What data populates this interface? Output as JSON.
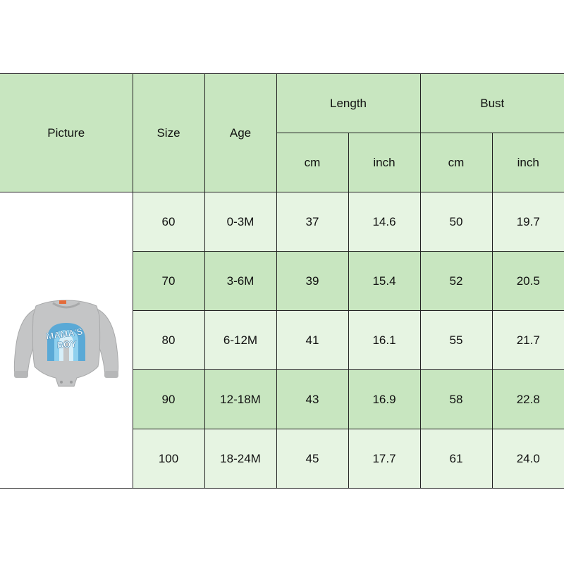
{
  "headers": {
    "picture": "Picture",
    "size": "Size",
    "age": "Age",
    "length": "Length",
    "bust": "Bust",
    "cm": "cm",
    "inch": "inch"
  },
  "product": {
    "print_text_line1": "MAMA'S",
    "print_text_line2": "BOY",
    "garment_color": "#c4c5c6",
    "rainbow_colors": [
      "#5aa9d6",
      "#8fd0ee",
      "#d7eff9"
    ]
  },
  "rows": [
    {
      "size": "60",
      "age": "0-3M",
      "length_cm": "37",
      "length_inch": "14.6",
      "bust_cm": "50",
      "bust_inch": "19.7"
    },
    {
      "size": "70",
      "age": "3-6M",
      "length_cm": "39",
      "length_inch": "15.4",
      "bust_cm": "52",
      "bust_inch": "20.5"
    },
    {
      "size": "80",
      "age": "6-12M",
      "length_cm": "41",
      "length_inch": "16.1",
      "bust_cm": "55",
      "bust_inch": "21.7"
    },
    {
      "size": "90",
      "age": "12-18M",
      "length_cm": "43",
      "length_inch": "16.9",
      "bust_cm": "58",
      "bust_inch": "22.8"
    },
    {
      "size": "100",
      "age": "18-24M",
      "length_cm": "45",
      "length_inch": "17.7",
      "bust_cm": "61",
      "bust_inch": "24.0"
    }
  ],
  "colors": {
    "header_bg": "#c8e6c0",
    "row_light": "#e6f4e2",
    "row_dark": "#c8e6c0",
    "border": "#222222"
  }
}
